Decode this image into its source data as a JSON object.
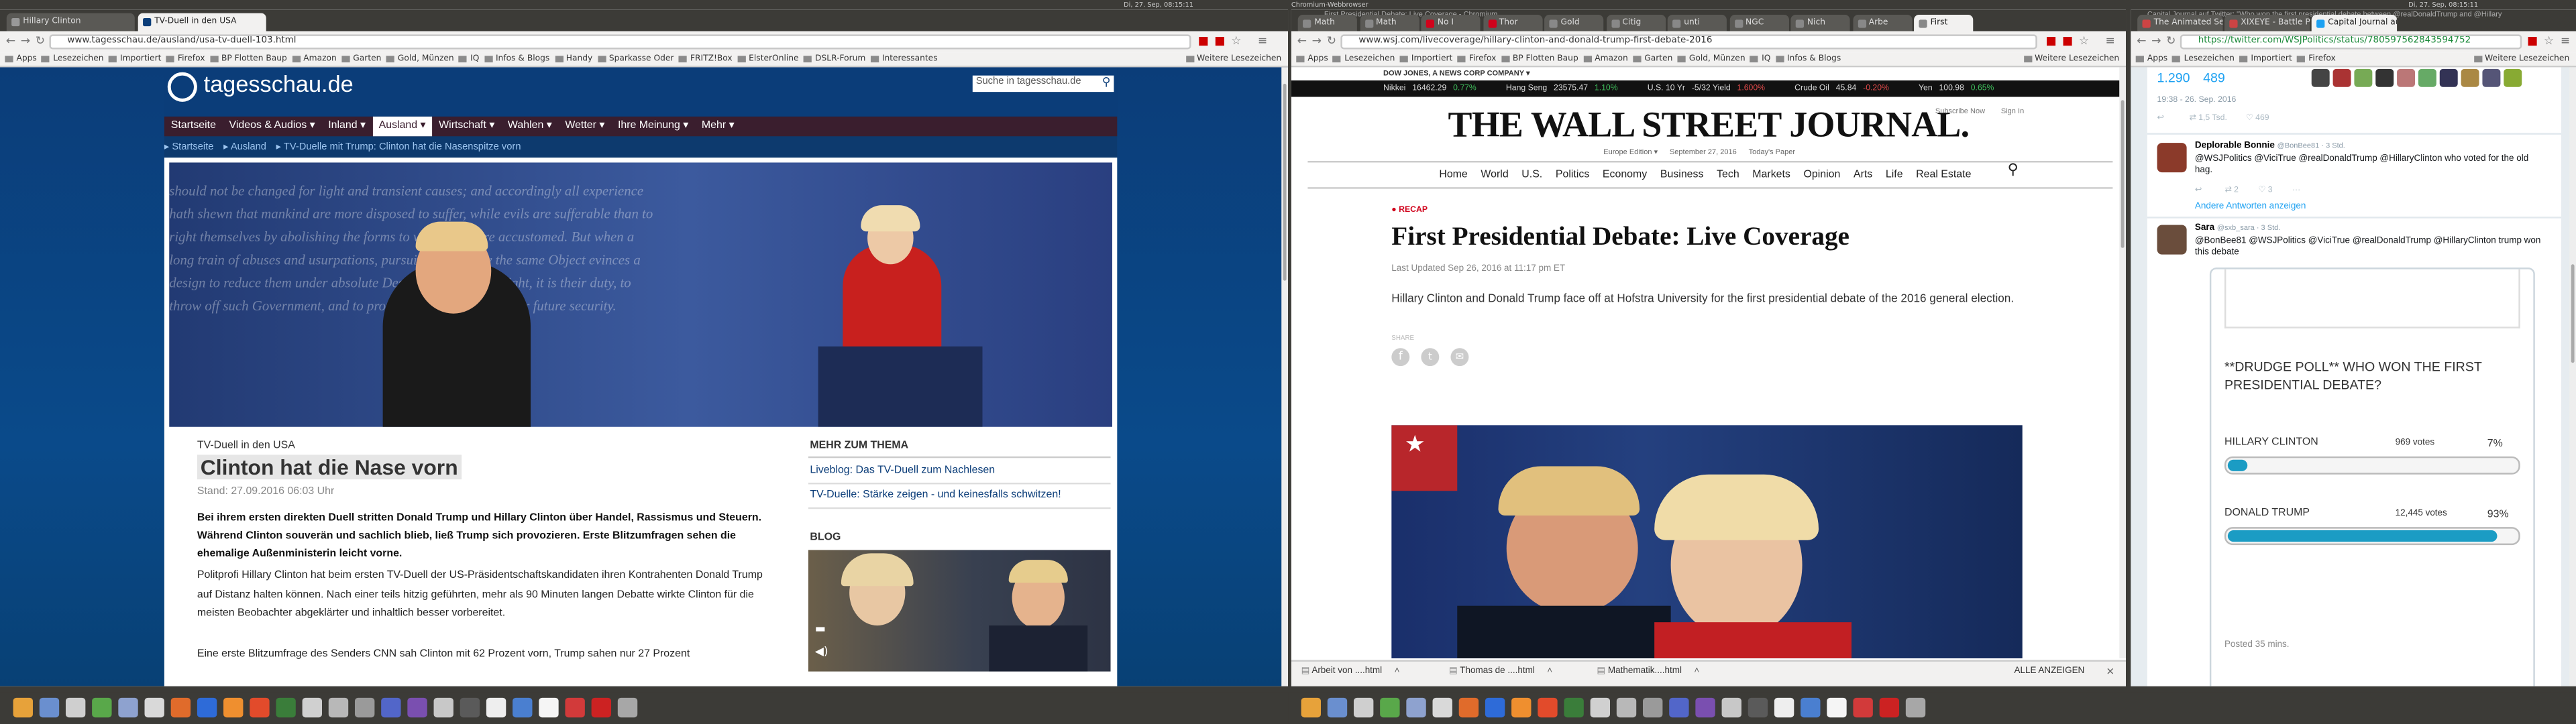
{
  "system": {
    "left_clock": "Di, 27. Sep, 08:15:11",
    "window_title": "Chromium-Webbrowser",
    "right_clock": "Di, 27. Sep, 08:15:11"
  },
  "win1": {
    "tabs": [
      "Hillary Clinton",
      "TV-Duell in den USA"
    ],
    "url": "www.tagesschau.de/ausland/usa-tv-duell-103.html",
    "bookmarks": [
      "Apps",
      "Lesezeichen",
      "Importiert",
      "Firefox",
      "BP Flotten Baup",
      "Amazon",
      "Garten",
      "Gold, Münzen",
      "IQ",
      "Infos & Blogs",
      "Handy",
      "Sparkasse Oder",
      "FRITZ!Box",
      "ElsterOnline",
      "DSLR-Forum",
      "Interessantes",
      "Weitere Lesezeichen"
    ],
    "logo": "tagesschau.de",
    "search_placeholder": "Suche in tagesschau.de",
    "menu": [
      "Startseite",
      "Videos & Audios ▾",
      "Inland ▾",
      "Ausland ▾",
      "Wirtschaft ▾",
      "Wahlen ▾",
      "Wetter ▾",
      "Ihre Meinung ▾",
      "Mehr ▾"
    ],
    "crumbs": [
      "Startseite",
      "Ausland",
      "TV-Duelle mit Trump: Clinton hat die Nasenspitze vorn"
    ],
    "kicker": "TV-Duell in den USA",
    "headline": "Clinton hat die Nase vorn",
    "stand": "Stand: 27.09.2016 06:03 Uhr",
    "lead": "Bei ihrem ersten direkten Duell stritten Donald Trump und Hillary Clinton über Handel, Rassismus und Steuern. Während Clinton souverän und sachlich blieb, ließ Trump sich provozieren. Erste Blitzumfragen sehen die ehemalige Außenministerin leicht vorne.",
    "body1": "Politprofi Hillary Clinton hat beim ersten TV-Duell der US-Präsidentschaftskandidaten ihren Kontrahenten Donald Trump auf Distanz halten können. Nach einer teils hitzig geführten, mehr als 90 Minuten langen Debatte wirkte Clinton für die meisten Beobachter abgeklärter und inhaltlich besser vorbereitet.",
    "body2": "Eine erste Blitzumfrage des Senders CNN sah Clinton mit 62 Prozent vorn, Trump sahen nur 27 Prozent",
    "more_title": "MEHR ZUM THEMA",
    "more_links": [
      "Liveblog: Das TV-Duell zum Nachlesen",
      "TV-Duelle: Stärke zeigen - und keinesfalls schwitzen!"
    ],
    "blog_title": "BLOG",
    "bg_text": [
      "should not be changed for light and transient causes; and accordingly all experience",
      "hath shewn that mankind are more disposed to suffer, while evils are sufferable than to",
      "right themselves by abolishing the forms to which they are accustomed. But when a",
      "long train of abuses and usurpations, pursuing invariably the same Object evinces a",
      "design to reduce them under absolute Despotism, it is their right, it is their duty, to",
      "throw off such Government, and to provide new Guards for their future security."
    ]
  },
  "win2": {
    "title": "First Presidential Debate: Live Coverage - Chromium",
    "tabs": [
      "Math",
      "Math",
      "No I",
      "Thor",
      "Gold",
      "Citig",
      "unti",
      "NGC",
      "Nich",
      "Arbe",
      "First"
    ],
    "url": "www.wsj.com/livecoverage/hillary-clinton-and-donald-trump-first-debate-2016",
    "bookmarks": [
      "Apps",
      "Lesezeichen",
      "Importiert",
      "Firefox",
      "BP Flotten Baup",
      "Amazon",
      "Garten",
      "Gold, Münzen",
      "IQ",
      "Infos & Blogs",
      "Weitere Lesezeichen"
    ],
    "dj": "DOW JONES, A NEWS CORP COMPANY ▾",
    "ticker": [
      {
        "n": "Nikkei",
        "v": "16462.29",
        "c": "0.77%",
        "up": true
      },
      {
        "n": "Hang Seng",
        "v": "23575.47",
        "c": "1.10%",
        "up": true
      },
      {
        "n": "U.S. 10 Yr",
        "v": "-5/32 Yield",
        "c": "1.600%",
        "up": false
      },
      {
        "n": "Crude Oil",
        "v": "45.84",
        "c": "-0.20%",
        "up": false
      },
      {
        "n": "Yen",
        "v": "100.98",
        "c": "0.65%",
        "up": true
      }
    ],
    "masthead": "THE WALL STREET JOURNAL.",
    "subscribe": "Subscribe Now",
    "signin": "Sign In",
    "edition": [
      "Europe Edition ▾",
      "September 27, 2016",
      "Today's Paper"
    ],
    "nav": [
      "Home",
      "World",
      "U.S.",
      "Politics",
      "Economy",
      "Business",
      "Tech",
      "Markets",
      "Opinion",
      "Arts",
      "Life",
      "Real Estate"
    ],
    "recap": "RECAP",
    "headline": "First Presidential Debate: Live Coverage",
    "updated": "Last Updated Sep 26, 2016 at 11:17 pm ET",
    "dek": "Hillary Clinton and Donald Trump face off at Hofstra University for the first presidential debate of the 2016 general election.",
    "share": "SHARE",
    "downloads": [
      "Arbeit von ....html",
      "Thomas de ....html",
      "Mathematik....html"
    ],
    "show_all": "ALLE ANZEIGEN"
  },
  "win3": {
    "title": "Capital Journal auf Twitter: \"Who won the first presidential debate between @realDonaldTrump and @Hillary",
    "tabs": [
      "The Animated Seri",
      "XIXEYE - Battle Pi",
      "Capital Journal au"
    ],
    "url": "https://twitter.com/WSJPolitics/status/780597562843594752",
    "bookmarks": [
      "Apps",
      "Lesezeichen",
      "Importiert",
      "Firefox",
      "Weitere Lesezeichen"
    ],
    "stats": [
      "1.290",
      "489"
    ],
    "time1": "19:38 - 26. Sep. 2016",
    "retweets1": "1,5 Tsd.",
    "likes1": "469",
    "reply1": {
      "name": "Deplorable Bonnie",
      "handle": "@BonBee81 · 3 Std.",
      "text": "@WSJPolitics @ViciTrue @realDonaldTrump @HillaryClinton who voted for the old hag.",
      "rt": "2",
      "like": "3"
    },
    "more_answers": "Andere Antworten anzeigen",
    "reply2": {
      "name": "Sara",
      "handle": "@sxb_sara · 3 Std.",
      "text": "@BonBee81 @WSJPolitics @ViciTrue @realDonaldTrump @HillaryClinton trump won this debate"
    },
    "poll": {
      "title": "**DRUDGE POLL** WHO WON THE FIRST PRESIDENTIAL DEBATE?",
      "rows": [
        {
          "name": "HILLARY CLINTON",
          "votes": "969 votes",
          "pct": "7%",
          "frac": 0.07
        },
        {
          "name": "DONALD TRUMP",
          "votes": "12,445 votes",
          "pct": "93%",
          "frac": 0.93
        }
      ],
      "posted": "Posted 35 mins."
    }
  },
  "colors": {
    "ts_blue": "#0b3d79",
    "ts_menu": "#3a1e2e",
    "wsj_red": "#d0021b",
    "twitter_blue": "#1da1f2",
    "poll_bar": "#1b9cc4"
  }
}
